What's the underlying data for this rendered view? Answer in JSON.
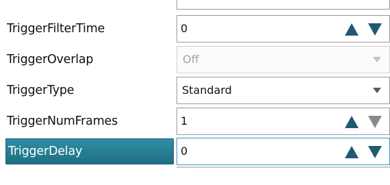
{
  "properties": [
    {
      "label": "TriggerFilterTime",
      "value": "0",
      "control": "spinner"
    },
    {
      "label": "TriggerOverlap",
      "value": "Off",
      "control": "dropdown",
      "disabled": true
    },
    {
      "label": "TriggerType",
      "value": "Standard",
      "control": "dropdown"
    },
    {
      "label": "TriggerNumFrames",
      "value": "1",
      "control": "spinner",
      "down_disabled": true
    },
    {
      "label": "TriggerDelay",
      "value": "0",
      "control": "spinner",
      "selected": true
    }
  ],
  "icons": {
    "spin_up": "triangle-up-icon",
    "spin_down": "triangle-down-icon",
    "dropdown": "chevron-down-icon"
  },
  "colors": {
    "spin_arrow": "#1f5a70",
    "spin_arrow_disabled": "#8a8a8a",
    "selection_bg": "#247a90",
    "dropdown_arrow": "#5a5a5a",
    "dropdown_arrow_disabled": "#c4c4c4"
  }
}
